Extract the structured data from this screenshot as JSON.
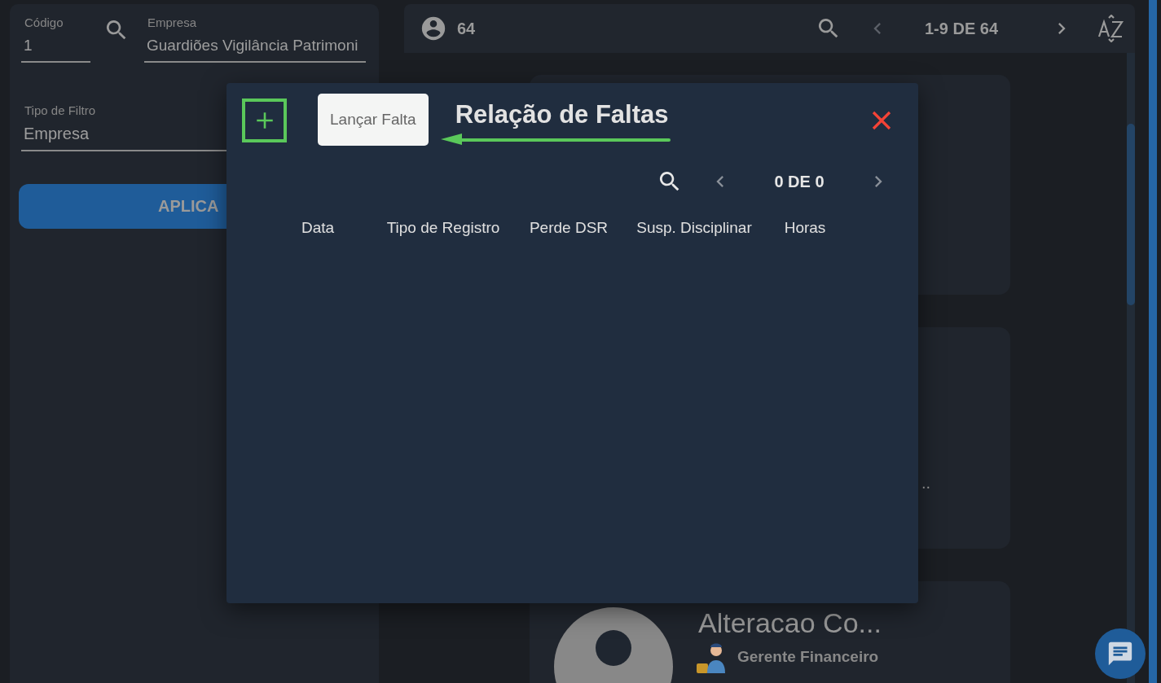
{
  "filters": {
    "code": {
      "label": "Código",
      "value": "1"
    },
    "company": {
      "label": "Empresa",
      "value": "Guardiões Vigilância Patrimoni"
    },
    "filter_type": {
      "label": "Tipo de Filtro",
      "value": "Empresa"
    },
    "apply_button": "APLICA"
  },
  "list_header": {
    "count": "64",
    "pagination": "1-9 DE 64"
  },
  "cards": [
    {
      "kind": "empty"
    },
    {
      "kind": "note",
      "text": ".."
    },
    {
      "kind": "person",
      "name": "Alteracao Co...",
      "role": "Gerente Financeiro"
    }
  ],
  "dialog": {
    "title": "Relação de Faltas",
    "tooltip": "Lançar Falta",
    "pagination": "0 DE 0",
    "columns": [
      "Data",
      "Tipo de Registro",
      "Perde DSR",
      "Susp. Disciplinar",
      "Horas"
    ]
  }
}
